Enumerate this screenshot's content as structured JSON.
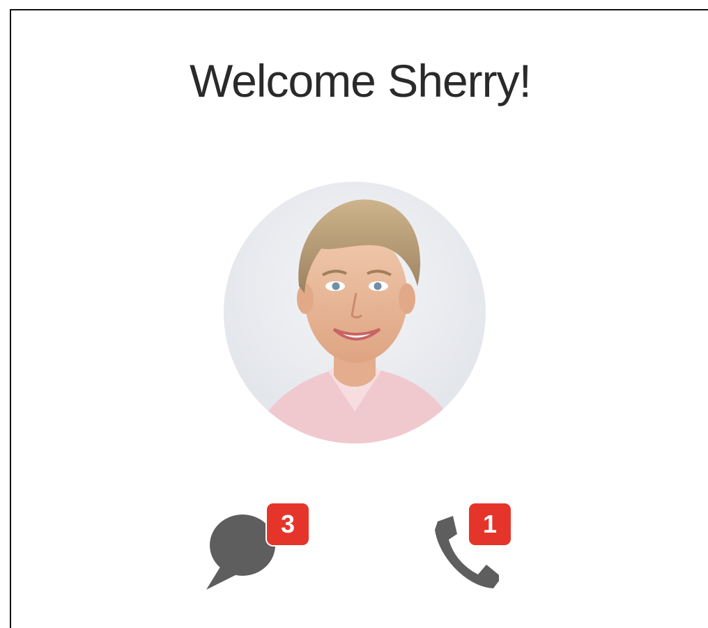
{
  "welcome": {
    "title": "Welcome Sherry!"
  },
  "profile": {
    "avatar_icon": "user-photo-avatar"
  },
  "actions": {
    "messages": {
      "icon": "chat-bubble-icon",
      "badge_count": "3"
    },
    "calls": {
      "icon": "phone-handset-icon",
      "badge_count": "1"
    }
  },
  "colors": {
    "badge": "#e5352b",
    "icon": "#5e5e5e",
    "title": "#2a2a2a"
  }
}
